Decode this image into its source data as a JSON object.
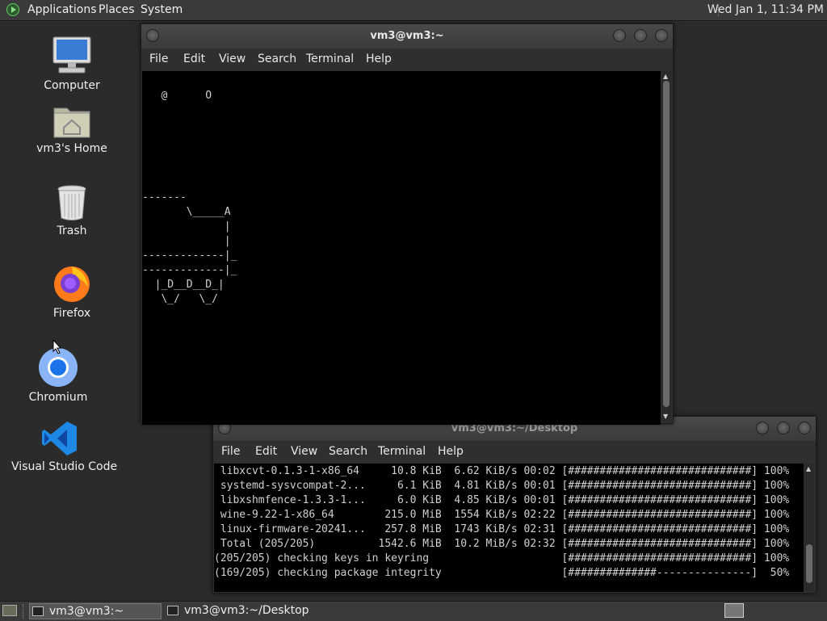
{
  "top_panel": {
    "applications": "Applications",
    "places": "Places",
    "system": "System",
    "clock": "Wed Jan  1, 11:34 PM"
  },
  "desktop_icons": [
    {
      "label": "Computer",
      "icon": "computer-icon"
    },
    {
      "label": "vm3's Home",
      "icon": "home-folder-icon"
    },
    {
      "label": "Trash",
      "icon": "trash-icon"
    },
    {
      "label": "Firefox",
      "icon": "firefox-icon"
    },
    {
      "label": "Chromium",
      "icon": "chromium-icon"
    },
    {
      "label": "Visual Studio Code",
      "icon": "vscode-icon"
    }
  ],
  "terminal1": {
    "title": "vm3@vm3:~",
    "menu": [
      "File",
      "Edit",
      "View",
      "Search",
      "Terminal",
      "Help"
    ],
    "content": "\n   @      O\n\n\n\n\n\n\n-------\n       \\_____A\n             |\n             |\n-------------|_\n-------------|_\n  |_D__D__D_|\n   \\_/   \\_/"
  },
  "terminal2": {
    "title": "vm3@vm3:~/Desktop",
    "menu": [
      "File",
      "Edit",
      "View",
      "Search",
      "Terminal",
      "Help"
    ],
    "lines": [
      " libxcvt-0.1.3-1-x86_64     10.8 KiB  6.62 KiB/s 00:02 [#############################] 100%",
      " systemd-sysvcompat-2...     6.1 KiB  4.81 KiB/s 00:01 [#############################] 100%",
      " libxshmfence-1.3.3-1...     6.0 KiB  4.85 KiB/s 00:01 [#############################] 100%",
      " wine-9.22-1-x86_64        215.0 MiB  1554 KiB/s 02:22 [#############################] 100%",
      " linux-firmware-20241...   257.8 MiB  1743 KiB/s 02:31 [#############################] 100%",
      " Total (205/205)          1542.6 MiB  10.2 MiB/s 02:32 [#############################] 100%",
      "(205/205) checking keys in keyring                     [#############################] 100%",
      "(169/205) checking package integrity                   [##############---------------]  50%"
    ]
  },
  "taskbar": [
    {
      "label": "vm3@vm3:~",
      "active": true
    },
    {
      "label": "vm3@vm3:~/Desktop",
      "active": false
    }
  ]
}
